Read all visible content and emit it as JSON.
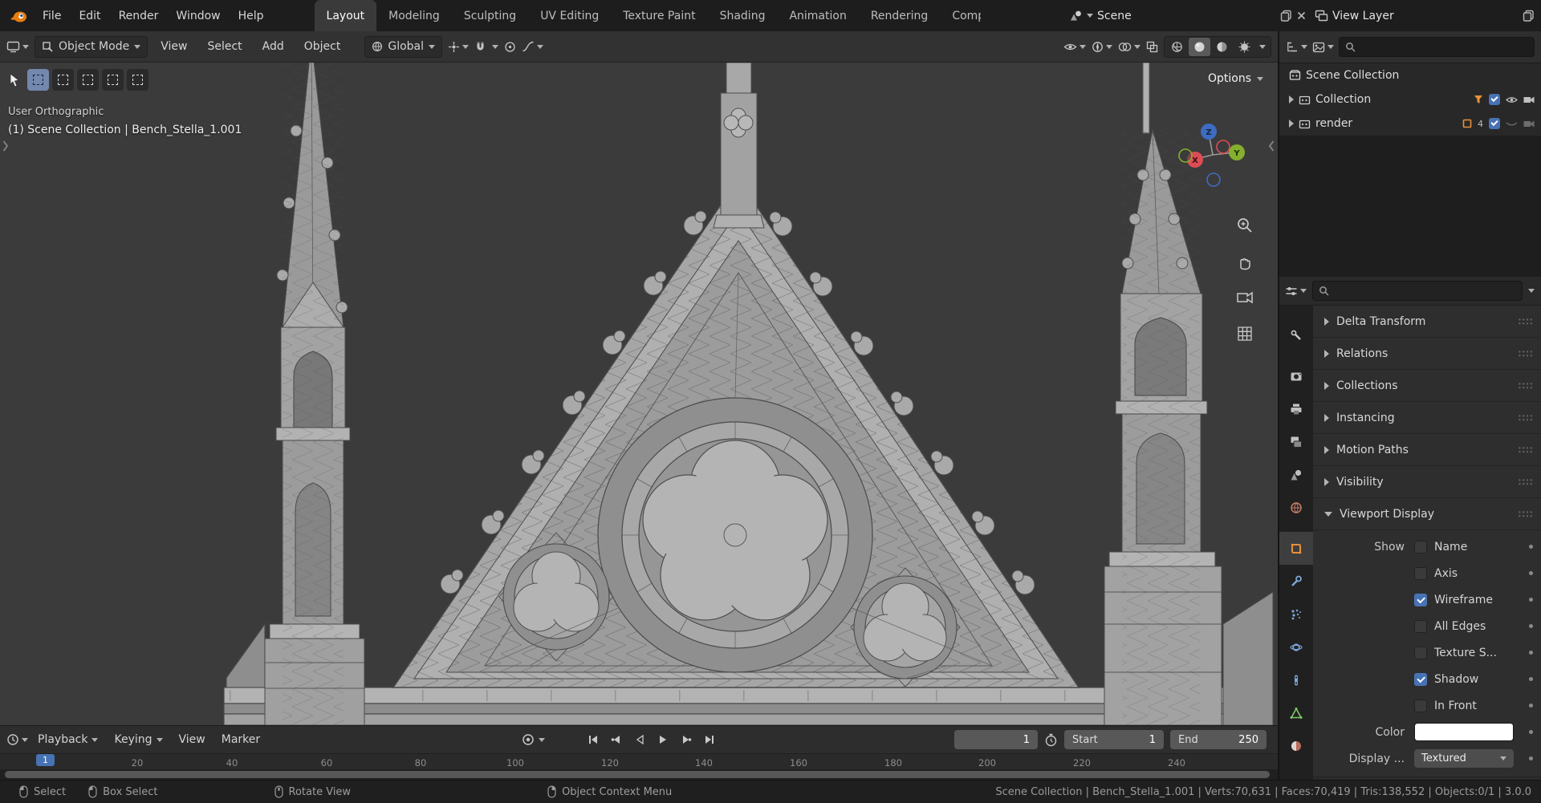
{
  "topbar": {
    "menus": [
      "File",
      "Edit",
      "Render",
      "Window",
      "Help"
    ],
    "tabs": [
      "Layout",
      "Modeling",
      "Sculpting",
      "UV Editing",
      "Texture Paint",
      "Shading",
      "Animation",
      "Rendering",
      "Compositing"
    ],
    "scene": {
      "label": "Scene"
    },
    "view_layer": {
      "label": "View Layer"
    }
  },
  "viewport_header": {
    "mode_selector": "Object Mode",
    "menus": [
      "View",
      "Select",
      "Add",
      "Object"
    ],
    "transform_orientation": "Global"
  },
  "viewport": {
    "overlay_title": "User Orthographic",
    "overlay_subtitle": "(1) Scene Collection | Bench_Stella_1.001",
    "options_label": "Options",
    "axis_gizmo": {
      "x": "X",
      "y": "Y",
      "z": "Z"
    }
  },
  "outliner": {
    "rows": [
      {
        "label": "Scene Collection"
      },
      {
        "label": "Collection"
      },
      {
        "label": "render",
        "count": "4"
      }
    ]
  },
  "properties": {
    "panels": [
      {
        "title": "Delta Transform"
      },
      {
        "title": "Relations"
      },
      {
        "title": "Collections"
      },
      {
        "title": "Instancing"
      },
      {
        "title": "Motion Paths"
      },
      {
        "title": "Visibility"
      }
    ],
    "viewport_display": {
      "title": "Viewport Display",
      "show_label": "Show",
      "options": [
        {
          "label": "Name",
          "checked": false
        },
        {
          "label": "Axis",
          "checked": false
        },
        {
          "label": "Wireframe",
          "checked": true
        },
        {
          "label": "All Edges",
          "checked": false
        },
        {
          "label": "Texture S...",
          "checked": false
        },
        {
          "label": "Shadow",
          "checked": true
        },
        {
          "label": "In Front",
          "checked": false
        }
      ],
      "color_label": "Color",
      "display_as_label": "Display ...",
      "display_as_value": "Textured"
    }
  },
  "timeline": {
    "menus": [
      "Playback",
      "Keying",
      "View",
      "Marker"
    ],
    "current_frame": "1",
    "start_label": "Start",
    "start_value": "1",
    "end_label": "End",
    "end_value": "250",
    "playhead_label": "1",
    "ticks": [
      "20",
      "40",
      "60",
      "80",
      "100",
      "120",
      "140",
      "160",
      "180",
      "200",
      "220",
      "240"
    ]
  },
  "statusbar": {
    "hints": [
      "Select",
      "Box Select",
      "Rotate View",
      "Object Context Menu"
    ],
    "stats": "Scene Collection | Bench_Stella_1.001 | Verts:70,631 | Faces:70,419 | Tris:138,552 | Objects:0/1 | 3.0.0"
  },
  "colors": {
    "accent": "#4772b3",
    "object_orange": "#e8913a",
    "axis_x": "#dd4c56",
    "axis_y": "#84b02e",
    "axis_z": "#3d6cc2"
  }
}
